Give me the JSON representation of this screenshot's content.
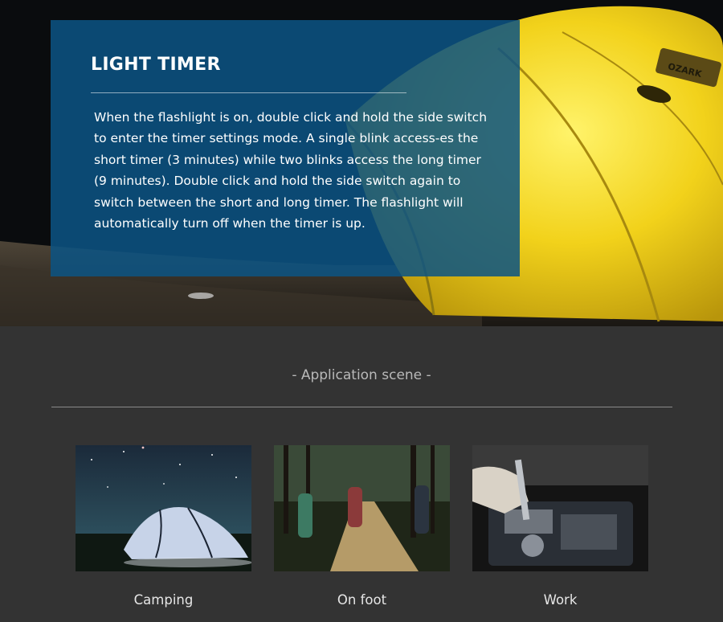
{
  "hero": {
    "title": "LIGHT TIMER",
    "description": "When the flashlight is on, double click and hold the side switch to enter the timer settings mode. A single blink access-es the short timer (3 minutes) while two blinks access the long timer (9 minutes). Double click and hold the side switch again to switch between the short and long timer. The flashlight will automatically turn off when the timer is up.",
    "tent_brand": "OZARK"
  },
  "applications": {
    "title": "- Application scene -",
    "scenes": [
      {
        "label": "Camping",
        "icon": "tent-photo"
      },
      {
        "label": "On foot",
        "icon": "hikers-photo"
      },
      {
        "label": "Work",
        "icon": "engine-photo"
      }
    ]
  },
  "colors": {
    "panel": "#0c5484",
    "tent": "#f2d21b",
    "section_bg": "#333333"
  }
}
